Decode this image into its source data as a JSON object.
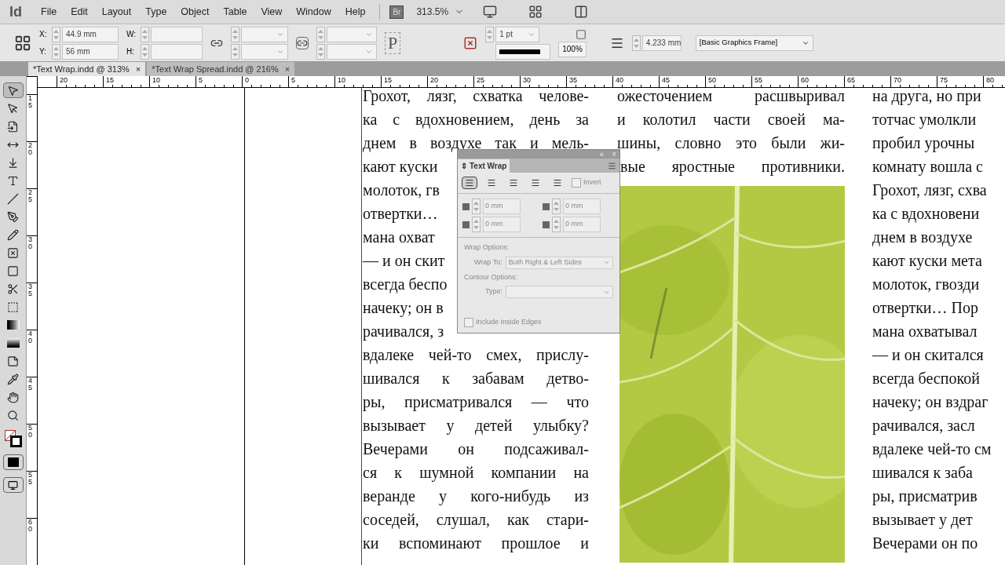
{
  "menu_bar": {
    "app_logo": "Id",
    "items": [
      "File",
      "Edit",
      "Layout",
      "Type",
      "Object",
      "Table",
      "View",
      "Window",
      "Help"
    ],
    "bridge": "Br",
    "zoom": "313.5%"
  },
  "control_panel": {
    "x_label": "X:",
    "x_value": "44.9 mm",
    "y_label": "Y:",
    "y_value": "56 mm",
    "w_label": "W:",
    "h_label": "H:",
    "reference_glyph": "P",
    "stroke_weight": "1 pt",
    "opacity": "100%",
    "fitting_offset": "4.233 mm",
    "object_style": "[Basic Graphics Frame]"
  },
  "document_tabs": [
    {
      "title": "*Text Wrap.indd @ 313%",
      "close": "×",
      "selected": true
    },
    {
      "title": "*Text Wrap Spread.indd @ 216%",
      "close": "×",
      "selected": false
    }
  ],
  "tools": [
    {
      "selected": true
    },
    {
      "selected": false
    },
    {
      "selected": false
    },
    {
      "selected": false
    },
    {
      "selected": false
    },
    {
      "selected": false
    },
    {
      "selected": false
    },
    {
      "selected": false
    },
    {
      "selected": false
    },
    {
      "selected": false
    },
    {
      "selected": false
    },
    {
      "selected": false
    },
    {
      "selected": false
    },
    {
      "selected": false
    },
    {
      "selected": false
    },
    {
      "selected": false
    },
    {
      "selected": false
    },
    {
      "selected": false
    },
    {
      "selected": false
    }
  ],
  "horizontal_ruler": [
    "20",
    "15",
    "10",
    "5",
    "0",
    "5",
    "10",
    "15",
    "20",
    "25",
    "30",
    "35",
    "40",
    "45",
    "50",
    "55",
    "60",
    "65",
    "70",
    "75",
    "80"
  ],
  "vertical_ruler": [
    "15",
    "20",
    "25",
    "30",
    "35",
    "40",
    "45",
    "50",
    "55",
    "60"
  ],
  "column_1": [
    {
      "text": "Грохот, лязг, схватка челове-",
      "full": true
    },
    {
      "text": "ка с вдохновением, день за",
      "full": true
    },
    {
      "text": "днем в воздухе так и мель-",
      "full": true
    },
    {
      "text": "кают куски",
      "full": false
    },
    {
      "text": "молоток, гв",
      "full": false
    },
    {
      "text": "отвертки…",
      "full": false
    },
    {
      "text": "мана охват",
      "full": false
    },
    {
      "text": "— и он скит",
      "full": false
    },
    {
      "text": "всегда беспо",
      "full": false
    },
    {
      "text": "начеку; он в",
      "full": false
    },
    {
      "text": "рачивался, з",
      "full": false
    },
    {
      "text": "вдалеке чей-то смех, прислу-",
      "full": true
    },
    {
      "text": "шивался к забавам детво-",
      "full": true
    },
    {
      "text": "ры, присматривался — что",
      "full": true
    },
    {
      "text": "вызывает у детей улыбку?",
      "full": true
    },
    {
      "text": "Вечерами он подсаживал-",
      "full": true
    },
    {
      "text": "ся к шумной компании на",
      "full": true
    },
    {
      "text": "веранде у кого-нибудь из",
      "full": true
    },
    {
      "text": "соседей, слушал, как стари-",
      "full": true
    },
    {
      "text": "ки вспоминают прошлое и",
      "full": true
    }
  ],
  "column_2": [
    "ожесточением расшвыривал",
    "и колотил части своей ма-",
    "шины, словно это были жи-",
    "вые яростные противники."
  ],
  "column_2_image": {
    "kind": "picture"
  },
  "column_3": [
    "на друга, но при",
    "тотчас умолкли",
    "пробил урочны",
    "комнату вошла с",
    "Грохот, лязг, схва",
    "ка с вдохновени",
    "днем в воздухе",
    "кают куски мета",
    "молоток, гвозди",
    "отвертки… Пор",
    "мана охватывал",
    "— и он скитался",
    "всегда беспокой",
    "начеку; он вздраг",
    "рачивался, засл",
    "вдалеке чей-то см",
    "шивался к заба",
    "ры, присматрив",
    "вызывает у дет",
    "Вечерами он по"
  ],
  "text_wrap_panel": {
    "collapse": "«",
    "close": "×",
    "tab_icon": "⇕",
    "tab": "Text Wrap",
    "wrap_modes": [
      {
        "selected": true
      },
      {
        "selected": false
      },
      {
        "selected": false
      },
      {
        "selected": false
      },
      {
        "selected": false
      }
    ],
    "invert": {
      "label": "Invert",
      "checked": false
    },
    "offsets": [
      "0 mm",
      "0 mm",
      "0 mm",
      "0 mm"
    ],
    "wrap_options_heading": "Wrap Options:",
    "wrap_to_label": "Wrap To:",
    "wrap_to_value": "Both Right & Left Sides",
    "contour_options_heading": "Contour Options:",
    "type_label": "Type:",
    "include_inside_edges": {
      "label": "Include Inside Edges",
      "checked": false
    }
  }
}
